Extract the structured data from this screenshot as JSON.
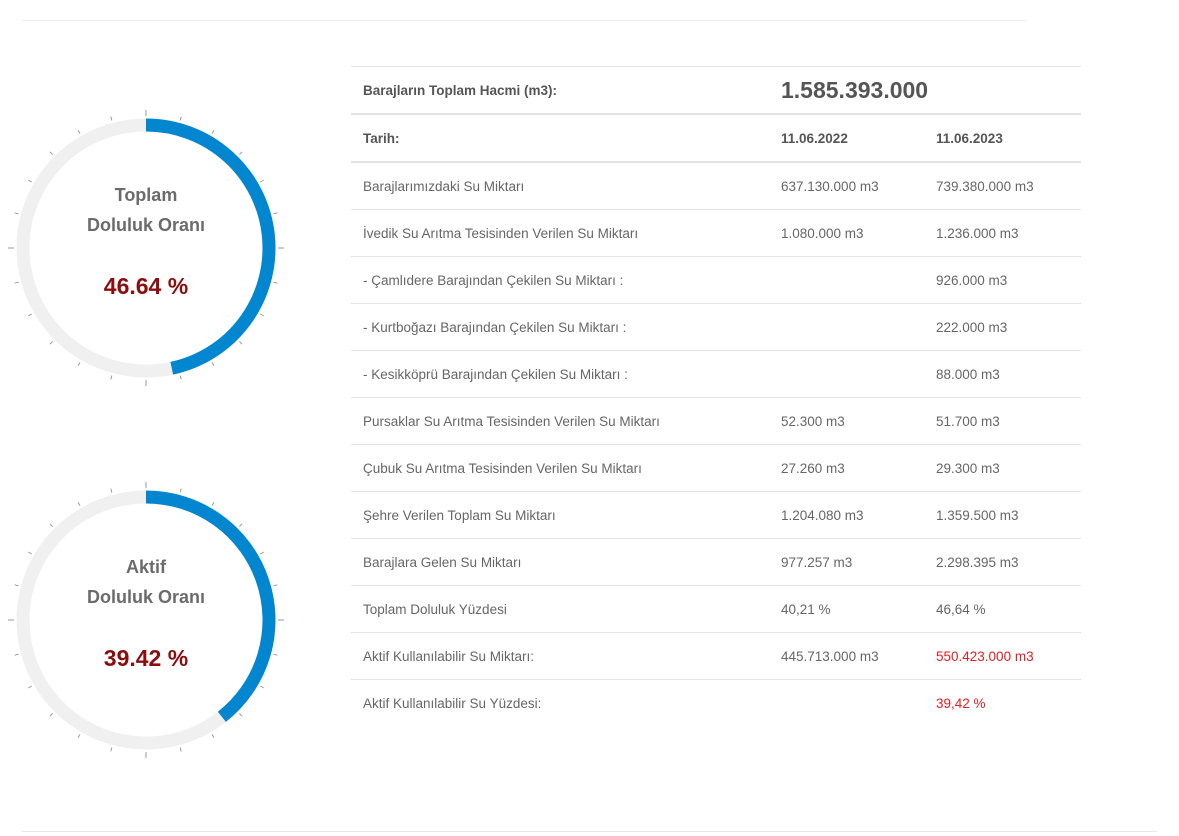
{
  "gauges": [
    {
      "label_line1": "Toplam",
      "label_line2": "Doluluk Oranı",
      "value": "46.64 %",
      "fraction": 0.4664
    },
    {
      "label_line1": "Aktif",
      "label_line2": "Doluluk Oranı",
      "value": "39.42 %",
      "fraction": 0.3942
    }
  ],
  "colors": {
    "arc": "#0286cf",
    "track": "#f0f0f0",
    "value": "#8b0d0d",
    "highlight": "#e31e24"
  },
  "table": {
    "total_label": "Barajların Toplam Hacmi (m3):",
    "total_value": "1.585.393.000",
    "date_label": "Tarih:",
    "date1": "11.06.2022",
    "date2": "11.06.2023",
    "rows": [
      {
        "label": "Barajlarımızdaki Su Miktarı",
        "v1": "637.130.000 m3",
        "v2": "739.380.000 m3"
      },
      {
        "label": "İvedik Su Arıtma Tesisinden Verilen Su Miktarı",
        "v1": "1.080.000 m3",
        "v2": "1.236.000 m3"
      },
      {
        "label": "- Çamlıdere Barajından Çekilen Su Miktarı :",
        "v1": "",
        "v2": "926.000 m3"
      },
      {
        "label": "- Kurtboğazı Barajından Çekilen Su Miktarı :",
        "v1": "",
        "v2": "222.000 m3"
      },
      {
        "label": "- Kesikköprü Barajından Çekilen Su Miktarı :",
        "v1": "",
        "v2": "88.000 m3"
      },
      {
        "label": "Pursaklar Su Arıtma Tesisinden Verilen Su Miktarı",
        "v1": "52.300 m3",
        "v2": "51.700 m3"
      },
      {
        "label": "Çubuk Su Arıtma Tesisinden Verilen Su Miktarı",
        "v1": "27.260 m3",
        "v2": "29.300 m3"
      },
      {
        "label": "Şehre Verilen Toplam Su Miktarı",
        "v1": "1.204.080 m3",
        "v2": "1.359.500 m3"
      },
      {
        "label": "Barajlara Gelen Su Miktarı",
        "v1": "977.257 m3",
        "v2": "2.298.395 m3"
      },
      {
        "label": "Toplam Doluluk Yüzdesi",
        "v1": "40,21 %",
        "v2": "46,64 %"
      },
      {
        "label": "Aktif Kullanılabilir Su Miktarı:",
        "v1": "445.713.000 m3",
        "v2": "550.423.000 m3",
        "highlight": true
      },
      {
        "label": "Aktif Kullanılabilir Su Yüzdesi:",
        "v1": "",
        "v2": "39,42 %",
        "highlight": true
      }
    ]
  }
}
